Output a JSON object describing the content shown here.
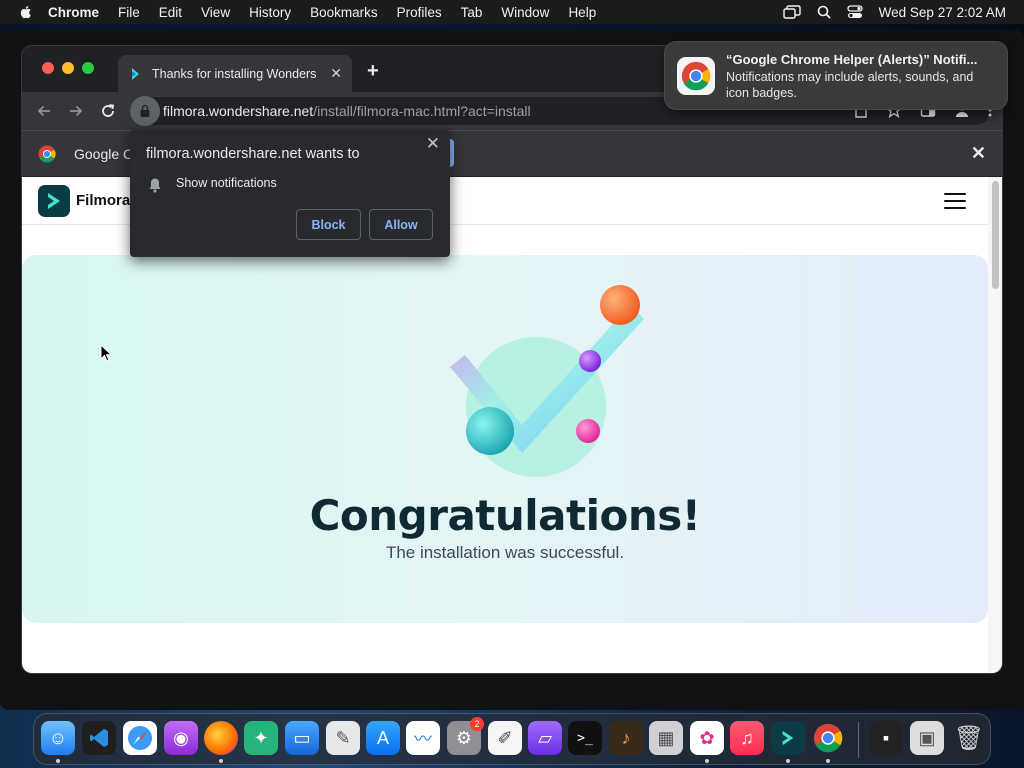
{
  "menubar": {
    "app": "Chrome",
    "items": [
      "File",
      "Edit",
      "View",
      "History",
      "Bookmarks",
      "Profiles",
      "Tab",
      "Window",
      "Help"
    ],
    "clock": "Wed Sep 27  2:02 AM"
  },
  "browser": {
    "tab_title": "Thanks for installing Wonders",
    "url_host": "filmora.wondershare.net",
    "url_path": "/install/filmora-mac.html?act=install",
    "infobar_text": "Google C"
  },
  "permission_popup": {
    "title": "filmora.wondershare.net wants to",
    "permission": "Show notifications",
    "block_label": "Block",
    "allow_label": "Allow"
  },
  "notification": {
    "title": "“Google Chrome Helper (Alerts)” Notifi...",
    "body": "Notifications may include alerts, sounds, and icon badges."
  },
  "page": {
    "site_name": "Filmora",
    "heading": "Congratulations!",
    "subheading": "The installation was successful."
  },
  "dock": {
    "apps": [
      "finder-icon",
      "vscode-icon",
      "safari-icon",
      "podcasts-icon",
      "firefox-icon",
      "wondershare-icon",
      "keynote-icon",
      "preview-icon",
      "app-store-icon",
      "freeform-icon",
      "system-settings-icon",
      "textedit-icon",
      "marker-icon",
      "terminal-icon",
      "garageband-icon",
      "launchpad-icon",
      "collage-icon",
      "music-icon",
      "filmora-icon",
      "chrome-icon",
      "desktop-icon",
      "screenshot-icon",
      "trash-icon"
    ],
    "settings_badge": "2"
  },
  "colors": {
    "accent": "#8ab4f8",
    "heading": "#0f2a33"
  }
}
